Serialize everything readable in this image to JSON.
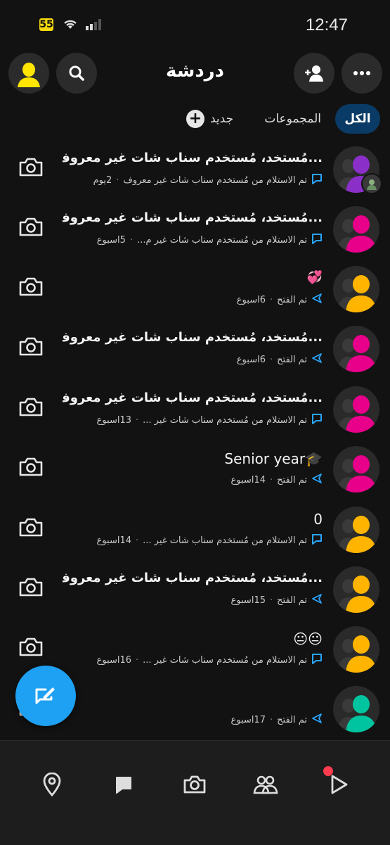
{
  "status_bar": {
    "time": "12:47",
    "battery": "55"
  },
  "header": {
    "title": "دردشة"
  },
  "filters": {
    "all": "الكل",
    "groups": "المجموعات",
    "new": "جديد"
  },
  "chats": [
    {
      "name": "...مُستخد، مُستخدم سناب شات غير معروف",
      "status": "تم الاستلام من مُستخدم سناب شات غير معروف",
      "time": "2يوم",
      "status_icon": "chat-bubble-icon",
      "avatar_color": "#8b2fc9",
      "has_badge": true
    },
    {
      "name": "...مُستخد، مُستخدم سناب شات غير معروف",
      "status": "تم الاستلام من مُستخدم سناب شات غير م...",
      "time": "5اسبوع",
      "status_icon": "chat-bubble-icon",
      "avatar_color": "#e8008a",
      "has_badge": false
    },
    {
      "name": "💞",
      "status": "تم الفتح",
      "time": "6اسبوع",
      "status_icon": "sent-arrow-icon",
      "avatar_color": "#ffb400",
      "has_badge": false
    },
    {
      "name": "...مُستخد، مُستخدم سناب شات غير معروف",
      "status": "تم الفتح",
      "time": "6اسبوع",
      "status_icon": "sent-arrow-icon",
      "avatar_color": "#e8008a",
      "has_badge": false
    },
    {
      "name": "...مُستخد، مُستخدم سناب شات غير معروف",
      "status": "تم الاستلام من مُستخدم سناب شات غير ...",
      "time": "13اسبوع",
      "status_icon": "chat-bubble-icon",
      "avatar_color": "#e8008a",
      "has_badge": false
    },
    {
      "name": "Senior year🎓",
      "status": "تم الفتح",
      "time": "14اسبوع",
      "status_icon": "sent-arrow-icon",
      "avatar_color": "#e8008a",
      "has_badge": false,
      "ltr": true
    },
    {
      "name": "0",
      "status": "تم الاستلام من مُستخدم سناب شات غير ...",
      "time": "14اسبوع",
      "status_icon": "chat-bubble-icon",
      "avatar_color": "#ffb400",
      "has_badge": false,
      "ltr": true
    },
    {
      "name": "...مُستخد، مُستخدم سناب شات غير معروف",
      "status": "تم الفتح",
      "time": "15اسبوع",
      "status_icon": "sent-arrow-icon",
      "avatar_color": "#ffb400",
      "has_badge": false
    },
    {
      "name": "😐😐",
      "status": "تم الاستلام من مُستخدم سناب شات غير ...",
      "time": "16اسبوع",
      "status_icon": "chat-bubble-icon",
      "avatar_color": "#ffb400",
      "has_badge": false,
      "ltr": true
    },
    {
      "name": "",
      "status": "تم الفتح",
      "time": "17اسبوع",
      "status_icon": "sent-arrow-icon",
      "avatar_color": "#00c4a0",
      "has_badge": false
    }
  ],
  "colors": {
    "accent": "#1ea1f2",
    "chip_active": "#0a3b66",
    "status_blue": "#2aa6ff",
    "notification": "#ff3b4f"
  },
  "nav": [
    "map-icon",
    "chat-icon",
    "camera-icon",
    "friends-icon",
    "spotlight-icon"
  ]
}
